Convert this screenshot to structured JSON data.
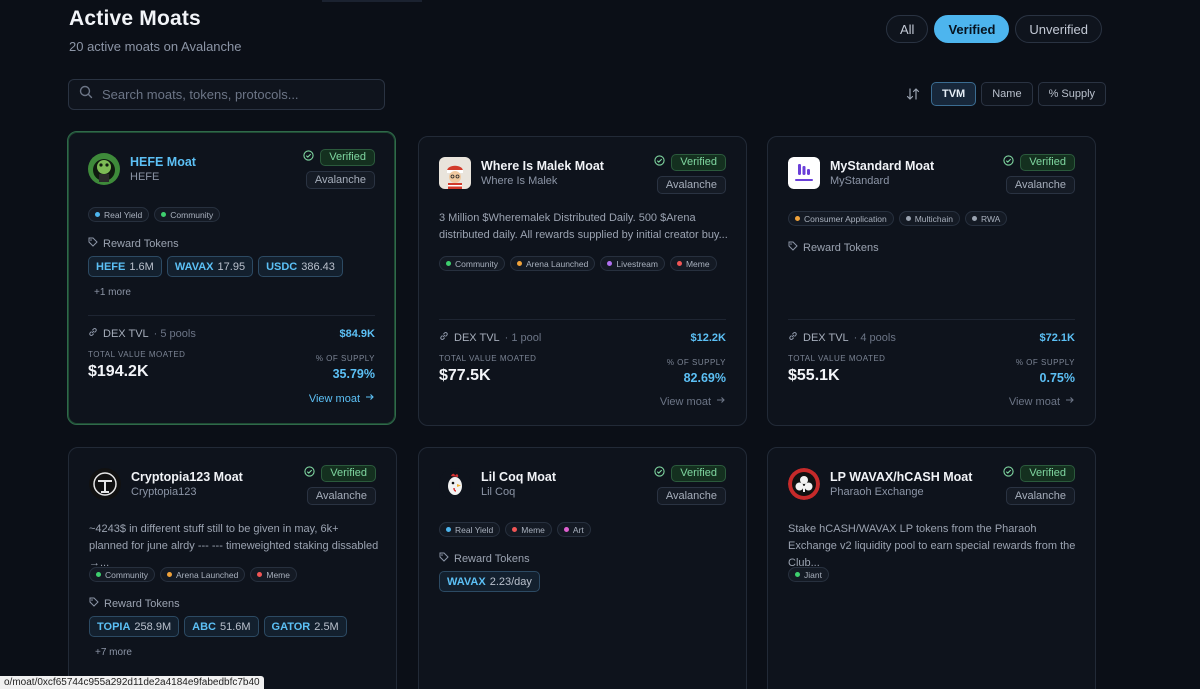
{
  "header": {
    "title": "Active Moats",
    "subtitle": "20 active moats on Avalanche"
  },
  "filters": [
    {
      "label": "All",
      "active": false
    },
    {
      "label": "Verified",
      "active": true
    },
    {
      "label": "Unverified",
      "active": false
    }
  ],
  "search": {
    "placeholder": "Search moats, tokens, protocols..."
  },
  "sort": [
    {
      "label": "TVM",
      "active": true
    },
    {
      "label": "Name",
      "active": false
    },
    {
      "label": "% Supply",
      "active": false
    }
  ],
  "labels": {
    "verified": "Verified",
    "chain": "Avalanche",
    "reward_tokens": "Reward Tokens",
    "total_value": "TOTAL VALUE MOATED",
    "pct_supply": "% OF SUPPLY",
    "view": "View moat",
    "dex": "DEX TVL"
  },
  "colors": {
    "accent": "#5cc0f5",
    "verified": "#7fd6a0"
  },
  "cards": [
    {
      "name": "HEFE Moat",
      "subtitle": "HEFE",
      "icon": "frog-avatar-icon",
      "tags": [
        {
          "label": "Real Yield",
          "color": "#4db5ee"
        },
        {
          "label": "Community",
          "color": "#3ecf6e"
        }
      ],
      "tokens": [
        {
          "sym": "HEFE",
          "amt": "1.6M"
        },
        {
          "sym": "WAVAX",
          "amt": "17.95"
        },
        {
          "sym": "USDC",
          "amt": "386.43"
        }
      ],
      "more": "+1 more",
      "dex_pools": "· 5 pools",
      "dex_val": "$84.9K",
      "tvm": "$194.2K",
      "pct": "35.79%"
    },
    {
      "name": "Where Is Malek Moat",
      "subtitle": "Where Is Malek",
      "icon": "malek-avatar-icon",
      "desc": "3 Million $Wheremalek Distributed Daily. 500 $Arena distributed daily. All rewards supplied by initial creator buy...",
      "tags": [
        {
          "label": "Community",
          "color": "#3ecf6e"
        },
        {
          "label": "Arena Launched",
          "color": "#f0a23a"
        },
        {
          "label": "Livestream",
          "color": "#b070f0"
        },
        {
          "label": "Meme",
          "color": "#f05555"
        }
      ],
      "dex_pools": "· 1 pool",
      "dex_val": "$12.2K",
      "tvm": "$77.5K",
      "pct": "82.69%"
    },
    {
      "name": "MyStandard Moat",
      "subtitle": "MyStandard",
      "icon": "mystandard-logo-icon",
      "tags": [
        {
          "label": "Consumer Application",
          "color": "#f0a23a"
        },
        {
          "label": "Multichain",
          "color": "#9aa3b0"
        },
        {
          "label": "RWA",
          "color": "#9aa3b0"
        }
      ],
      "dex_pools": "· 4 pools",
      "dex_val": "$72.1K",
      "tvm": "$55.1K",
      "pct": "0.75%"
    },
    {
      "name": "Cryptopia123 Moat",
      "subtitle": "Cryptopia123",
      "icon": "cryptopia-logo-icon",
      "desc": "~4243$ in different stuff still to be given in may, 6k+ planned for june alrdy --- --- timeweighted staking dissabled →...",
      "tags": [
        {
          "label": "Community",
          "color": "#3ecf6e"
        },
        {
          "label": "Arena Launched",
          "color": "#f0a23a"
        },
        {
          "label": "Meme",
          "color": "#f05555"
        }
      ],
      "tokens": [
        {
          "sym": "TOPIA",
          "amt": "258.9M"
        },
        {
          "sym": "ABC",
          "amt": "51.6M"
        },
        {
          "sym": "GATOR",
          "amt": "2.5M"
        }
      ],
      "more": "+7 more"
    },
    {
      "name": "Lil Coq Moat",
      "subtitle": "Lil Coq",
      "icon": "rooster-avatar-icon",
      "tags": [
        {
          "label": "Real Yield",
          "color": "#4db5ee"
        },
        {
          "label": "Meme",
          "color": "#f05555"
        },
        {
          "label": "Art",
          "color": "#e060d0"
        }
      ],
      "tokens": [
        {
          "sym": "WAVAX",
          "amt": "2.23/day"
        }
      ]
    },
    {
      "name": "LP WAVAX/hCASH Moat",
      "subtitle": "Pharaoh Exchange",
      "icon": "pharaoh-logo-icon",
      "desc": "Stake hCASH/WAVAX LP tokens from the Pharaoh Exchange v2 liquidity pool to earn special rewards from the Club...",
      "tags": [
        {
          "label": "Jiant",
          "color": "#3ecf6e"
        }
      ]
    }
  ],
  "statusbar": {
    "url": "o/moat/0xcf65744c955a292d11de2a4184e9fabedbfc7b40"
  }
}
